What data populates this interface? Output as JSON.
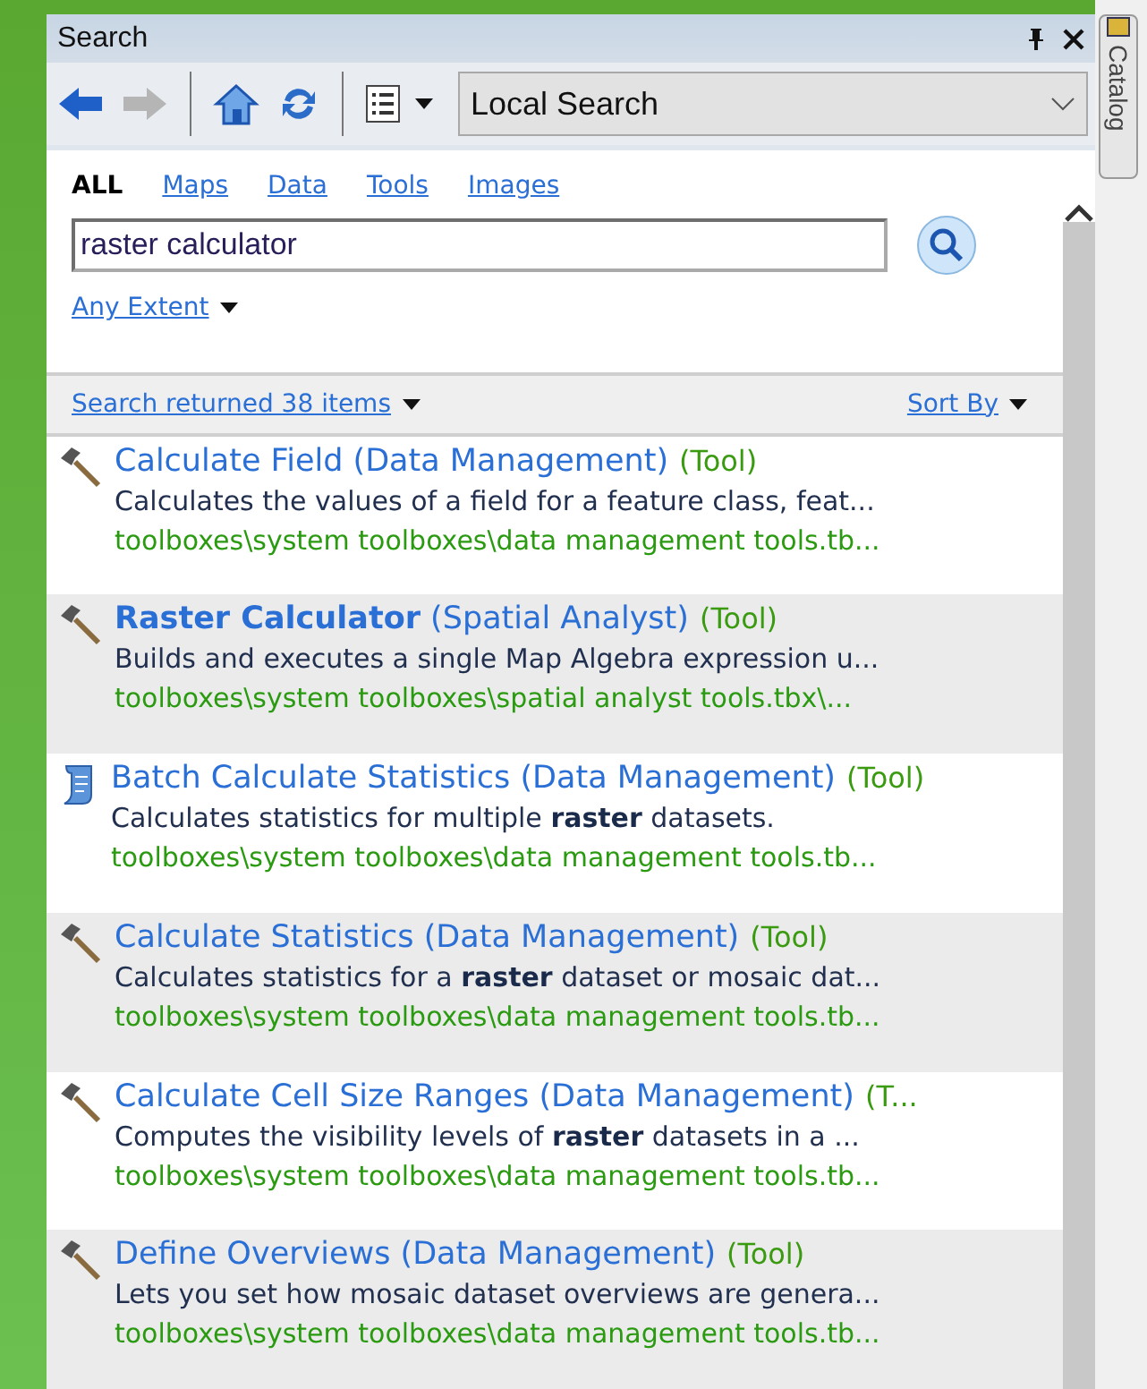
{
  "window": {
    "title": "Search",
    "side_tab": "Catalog"
  },
  "toolbar": {
    "scope": "Local Search"
  },
  "filters": [
    {
      "label": "ALL",
      "selected": true
    },
    {
      "label": "Maps",
      "selected": false
    },
    {
      "label": "Data",
      "selected": false
    },
    {
      "label": "Tools",
      "selected": false
    },
    {
      "label": "Images",
      "selected": false
    }
  ],
  "search": {
    "value": "raster calculator"
  },
  "extent": "Any Extent",
  "results_header": {
    "count": "Search returned 38 items",
    "sort": "Sort By"
  },
  "results": [
    {
      "kind": "tool",
      "title": "Calculate Field (Data Management)",
      "type": "(Tool)",
      "description": "Calculates the values of a field for a feature class, feat...",
      "path": "toolboxes\\system toolboxes\\data management tools.tb..."
    },
    {
      "kind": "tool",
      "title": "**Raster Calculator** (Spatial Analyst)",
      "type": "(Tool)",
      "description": "Builds and executes a single Map Algebra expression u...",
      "path": "toolboxes\\system toolboxes\\spatial analyst tools.tbx\\..."
    },
    {
      "kind": "script",
      "title": "Batch Calculate Statistics (Data Management)",
      "type": "(Tool)",
      "description": "Calculates statistics for multiple **raster** datasets.",
      "path": "toolboxes\\system toolboxes\\data management tools.tb..."
    },
    {
      "kind": "tool",
      "title": "Calculate Statistics (Data Management)",
      "type": "(Tool)",
      "description": "Calculates statistics for a **raster** dataset or mosaic dat...",
      "path": "toolboxes\\system toolboxes\\data management tools.tb..."
    },
    {
      "kind": "tool",
      "title": "Calculate Cell Size Ranges (Data Management)",
      "type": "(T...",
      "description": "Computes the visibility levels of **raster** datasets in a ...",
      "path": "toolboxes\\system toolboxes\\data management tools.tb..."
    },
    {
      "kind": "tool",
      "title": "Define Overviews (Data Management)",
      "type": "(Tool)",
      "description": "Lets you set how mosaic dataset overviews are genera...",
      "path": "toolboxes\\system toolboxes\\data management tools.tb..."
    }
  ]
}
